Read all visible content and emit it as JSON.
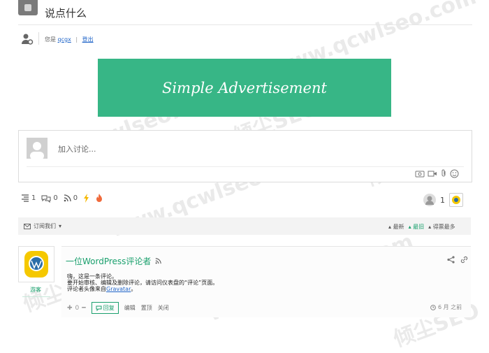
{
  "header": {
    "title": "说点什么"
  },
  "user": {
    "prefix": "您是",
    "name": "qcgx",
    "logout": "登出"
  },
  "ad": {
    "text": "Simple Advertisement"
  },
  "comment_input": {
    "placeholder": "加入讨论..."
  },
  "stats": {
    "threads": "1",
    "replies": "0",
    "followers": "0",
    "participants": "1"
  },
  "subscribe": {
    "label": "订阅我们"
  },
  "sort": {
    "newest": "最新",
    "oldest": "最旧",
    "most_voted": "得票最多"
  },
  "comment": {
    "author": "一位WordPress评论者",
    "role": "游客",
    "lines": [
      "嗨，这是一条评论。",
      "要开始审核、编辑及删除评论，请访问仪表盘的“评论”页面。",
      "评论者头像来自"
    ],
    "gravatar": "Gravatar",
    "period": "。",
    "votes": "0",
    "reply": "回复",
    "edit": "编辑",
    "pin": "置顶",
    "close": "关闭",
    "time": "6 月 之前"
  },
  "watermark": {
    "text1": "www.qcwlseo.com",
    "text2": "倾尘SEO"
  },
  "colors": {
    "accent": "#1aa06d",
    "ad_bg": "#37b686",
    "link": "#1f64c8"
  }
}
